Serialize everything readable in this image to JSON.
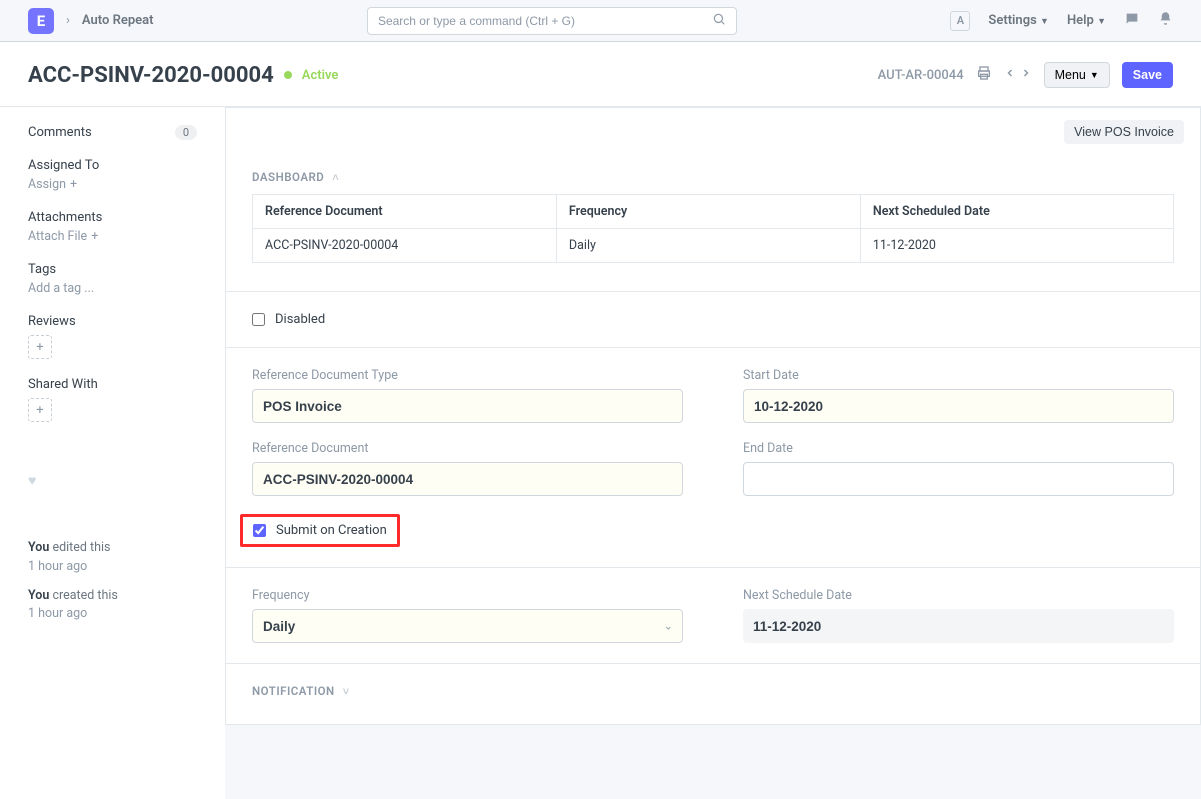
{
  "breadcrumb": {
    "item": "Auto Repeat"
  },
  "search": {
    "placeholder": "Search or type a command (Ctrl + G)"
  },
  "topnav": {
    "avatar_initial": "A",
    "settings": "Settings",
    "help": "Help"
  },
  "header": {
    "title": "ACC-PSINV-2020-00004",
    "status": "Active",
    "toolbar_id": "AUT-AR-00044",
    "menu": "Menu",
    "save": "Save"
  },
  "sidebar": {
    "comments": {
      "label": "Comments",
      "count": "0"
    },
    "assigned_to": {
      "label": "Assigned To",
      "action": "Assign"
    },
    "attachments": {
      "label": "Attachments",
      "action": "Attach File"
    },
    "tags": {
      "label": "Tags",
      "action": "Add a tag ..."
    },
    "reviews": {
      "label": "Reviews"
    },
    "shared_with": {
      "label": "Shared With"
    },
    "activity": {
      "line1_you": "You",
      "line1_text": " edited this",
      "line1_time": "1 hour ago",
      "line2_you": "You",
      "line2_text": " created this",
      "line2_time": "1 hour ago"
    }
  },
  "main": {
    "view_pos": "View POS Invoice",
    "dashboard": {
      "heading": "DASHBOARD",
      "col1": "Reference Document",
      "col2": "Frequency",
      "col3": "Next Scheduled Date",
      "row": {
        "ref": "ACC-PSINV-2020-00004",
        "freq": "Daily",
        "next": "11-12-2020"
      }
    },
    "disabled_label": "Disabled",
    "ref_doc_type": {
      "label": "Reference Document Type",
      "value": "POS Invoice"
    },
    "ref_doc": {
      "label": "Reference Document",
      "value": "ACC-PSINV-2020-00004"
    },
    "start_date": {
      "label": "Start Date",
      "value": "10-12-2020"
    },
    "end_date": {
      "label": "End Date",
      "value": ""
    },
    "submit_on_creation": "Submit on Creation",
    "frequency": {
      "label": "Frequency",
      "value": "Daily"
    },
    "next_schedule": {
      "label": "Next Schedule Date",
      "value": "11-12-2020"
    },
    "notification": "NOTIFICATION"
  }
}
